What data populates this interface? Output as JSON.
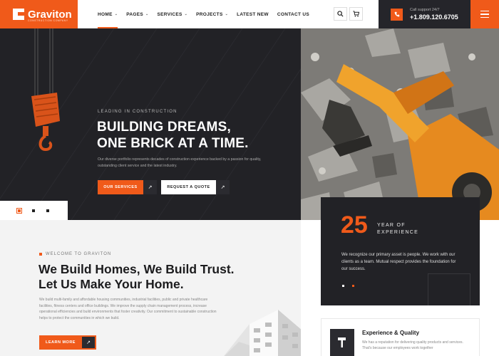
{
  "brand": {
    "name": "Graviton",
    "tagline": "CONSTRUCTION COMPANY",
    "accent": "#f05a1a",
    "dark": "#222226"
  },
  "nav": {
    "items": [
      {
        "label": "HOME",
        "chevron": true,
        "active": true
      },
      {
        "label": "PAGES",
        "chevron": true
      },
      {
        "label": "SERVICES",
        "chevron": true
      },
      {
        "label": "PROJECTS",
        "chevron": true
      },
      {
        "label": "LATEST NEW",
        "chevron": false
      },
      {
        "label": "CONTACT US",
        "chevron": false
      }
    ],
    "search_icon": "search-icon",
    "cart_icon": "cart-icon"
  },
  "support": {
    "label": "Call support 24/7",
    "phone": "+1.809.120.6705",
    "icon": "phone-icon"
  },
  "hero": {
    "pre_title": "LEADING IN CONSTRUCTION",
    "title_line1": "BUILDING DREAMS,",
    "title_line2": "ONE BRICK AT A TIME.",
    "description": "Our diverse portfolio represents decades of construction experience backed by a passion for quality, outstanding client service and the latest industry.",
    "primary_button": "OUR SERVICES",
    "secondary_button": "REQUEST A QUOTE",
    "slide_count": 3,
    "active_slide": 1
  },
  "about": {
    "eyebrow": "WELCOME TO GRAVITON",
    "title_line1": "We Build Homes, We Build Trust.",
    "title_line2": "Let Us Make Your Home.",
    "description": "We build multi-family and affordable housing communities, industrial facilities, public and private healthcare facilities, fitness centers and office buildings. We improve the supply chain management process, increase operational efficiencies and build environments that foster creativity. Our commitment to sustainable construction helps to protect the communities in which we build.",
    "button": "LEARN MORE"
  },
  "stats": {
    "number": "25",
    "label_line1": "YEAR OF",
    "label_line2": "EXPERIENCE",
    "description": "We recognize our primary asset is people. We work with our clients as a team. Mutual respect provides the foundation for our success."
  },
  "feature": {
    "title": "Experience & Quality",
    "description": "We has a reputation for delivering quality products and services. That's because our employees work together",
    "icon": "hammer-icon"
  }
}
